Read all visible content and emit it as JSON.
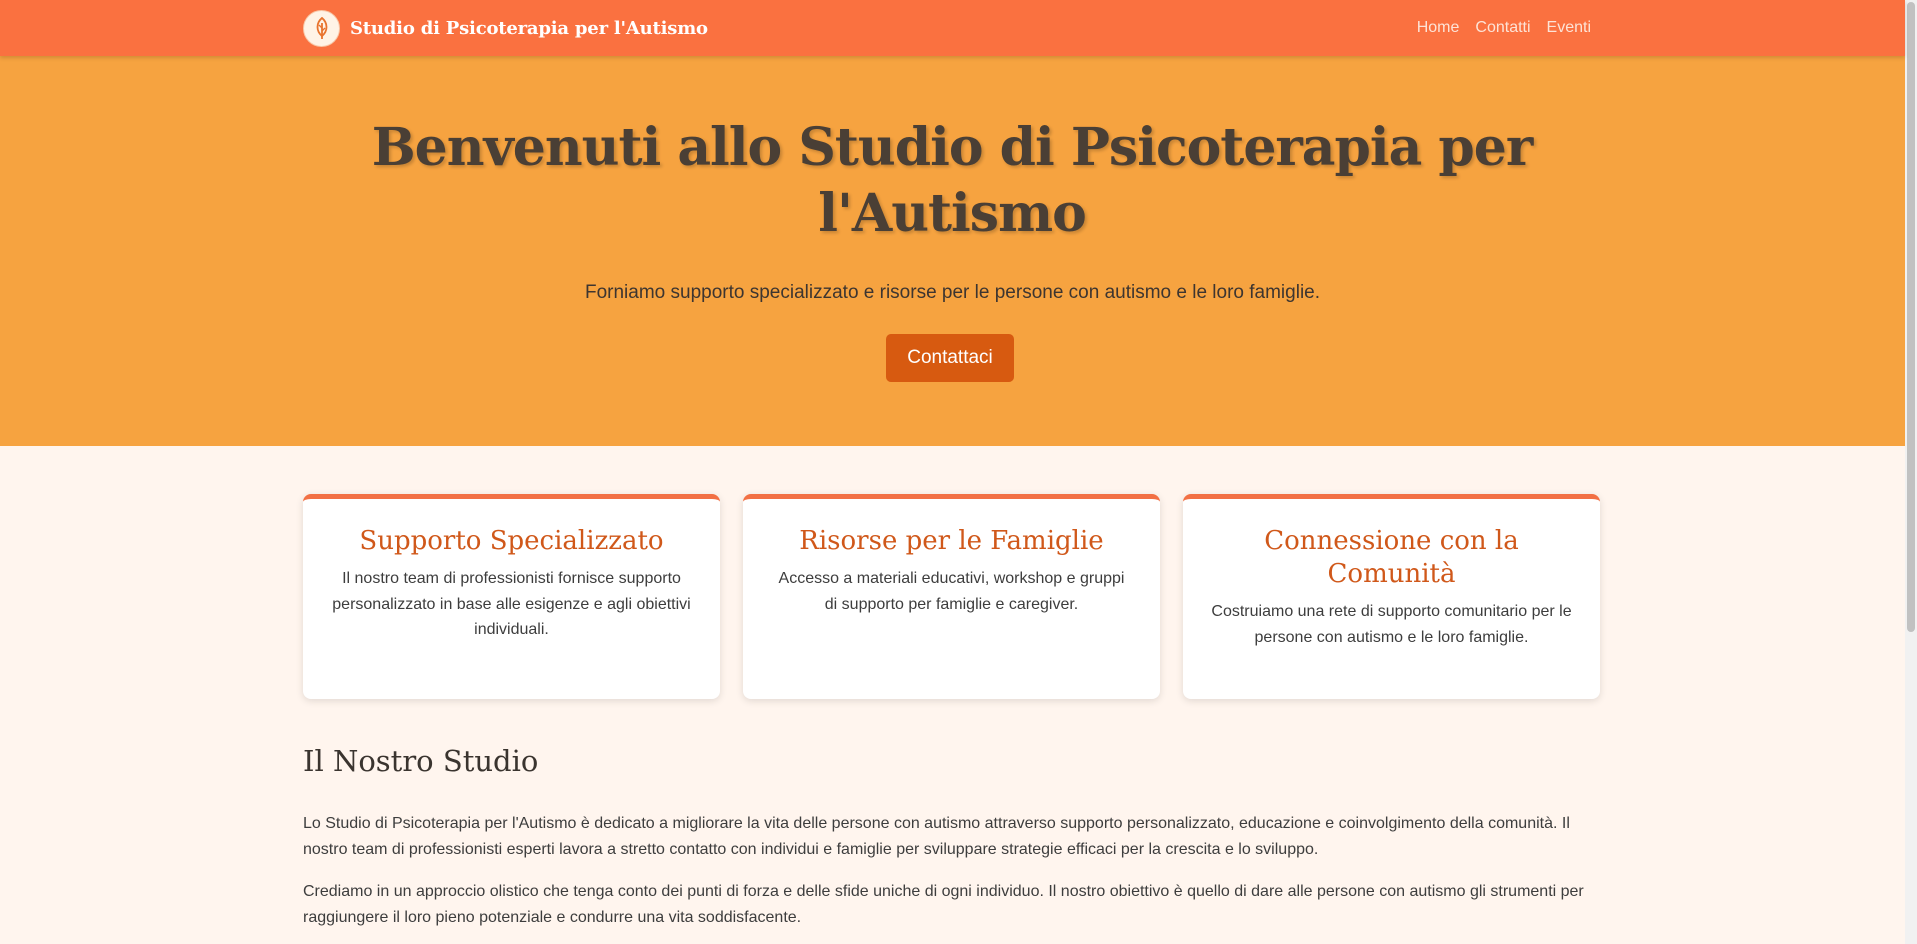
{
  "navbar": {
    "brand_title": "Studio di Psicoterapia per l'Autismo",
    "logo_icon": "tree-logo-icon",
    "links": [
      "Home",
      "Contatti",
      "Eventi"
    ]
  },
  "hero": {
    "title": "Benvenuti allo Studio di Psicoterapia per l'Autismo",
    "subtitle": "Forniamo supporto specializzato e risorse per le persone con autismo e le loro famiglie.",
    "cta_label": "Contattaci"
  },
  "cards": [
    {
      "title": "Supporto Specializzato",
      "text": "Il nostro team di professionisti fornisce supporto personalizzato in base alle esigenze e agli obiettivi individuali."
    },
    {
      "title": "Risorse per le Famiglie",
      "text": "Accesso a materiali educativi, workshop e gruppi di supporto per famiglie e caregiver."
    },
    {
      "title": "Connessione con la Comunità",
      "text": "Costruiamo una rete di supporto comunitario per le persone con autismo e le loro famiglie."
    }
  ],
  "about": {
    "title": "Il Nostro Studio",
    "paragraphs": [
      "Lo Studio di Psicoterapia per l'Autismo è dedicato a migliorare la vita delle persone con autismo attraverso supporto personalizzato, educazione e coinvolgimento della comunità. Il nostro team di professionisti esperti lavora a stretto contatto con individui e famiglie per sviluppare strategie efficaci per la crescita e lo sviluppo.",
      "Crediamo in un approccio olistico che tenga conto dei punti di forza e delle sfide uniche di ogni individuo. Il nostro obiettivo è quello di dare alle persone con autismo gli strumenti per raggiungere il loro pieno potenziale e condurre una vita soddisfacente."
    ]
  },
  "colors": {
    "navbar": "#fa7140",
    "hero": "#f6a340",
    "button": "#d75a10",
    "card_title": "#d0581a",
    "page_bg": "#fff5ee"
  }
}
